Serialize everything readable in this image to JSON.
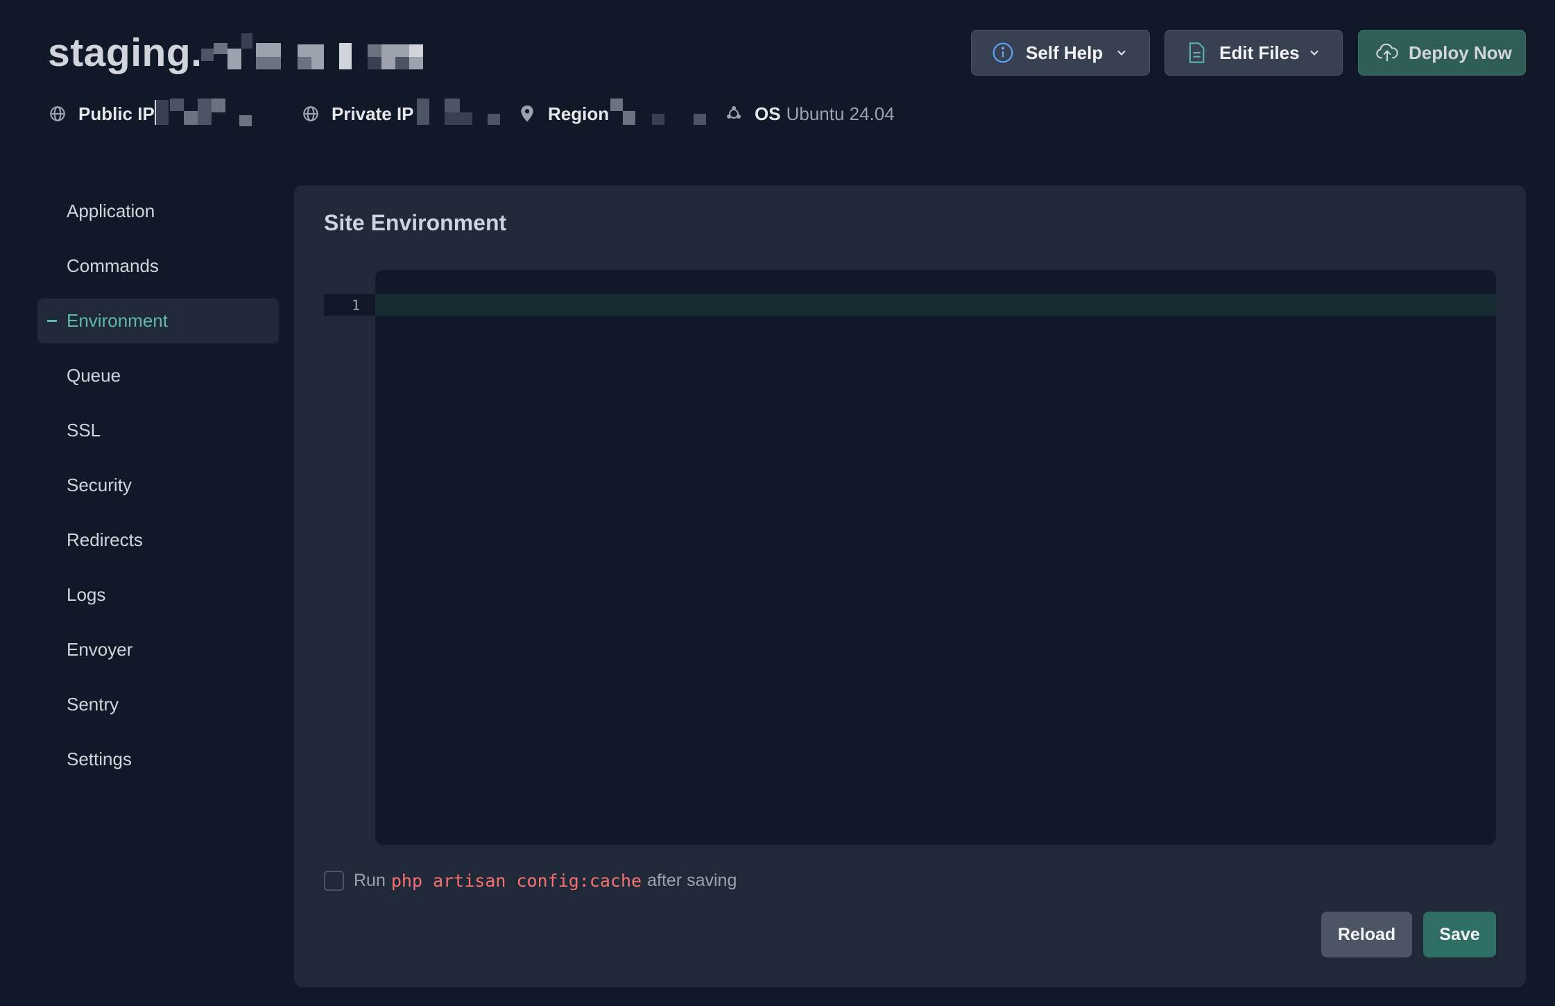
{
  "header": {
    "site_title": "staging.",
    "meta": {
      "public_ip_label": "Public IP",
      "private_ip_label": "Private IP",
      "region_label": "Region",
      "os_label": "OS",
      "os_value": "Ubuntu 24.04"
    },
    "buttons": {
      "self_help": "Self Help",
      "edit_files": "Edit Files",
      "deploy_now": "Deploy Now"
    }
  },
  "sidebar": {
    "items": [
      {
        "label": "Application",
        "active": false
      },
      {
        "label": "Commands",
        "active": false
      },
      {
        "label": "Environment",
        "active": true
      },
      {
        "label": "Queue",
        "active": false
      },
      {
        "label": "SSL",
        "active": false
      },
      {
        "label": "Security",
        "active": false
      },
      {
        "label": "Redirects",
        "active": false
      },
      {
        "label": "Logs",
        "active": false
      },
      {
        "label": "Envoyer",
        "active": false
      },
      {
        "label": "Sentry",
        "active": false
      },
      {
        "label": "Settings",
        "active": false
      }
    ]
  },
  "panel": {
    "title": "Site Environment",
    "editor": {
      "line_number": "1"
    },
    "option": {
      "prefix": "Run",
      "command": "php artisan config:cache",
      "suffix": "after saving",
      "checked": false
    },
    "buttons": {
      "reload": "Reload",
      "save": "Save"
    }
  },
  "colors": {
    "background": "#111827",
    "panel": "#1f2937",
    "accent": "#5fb8a8",
    "deploy": "#2f5e57",
    "command": "#f87171"
  }
}
